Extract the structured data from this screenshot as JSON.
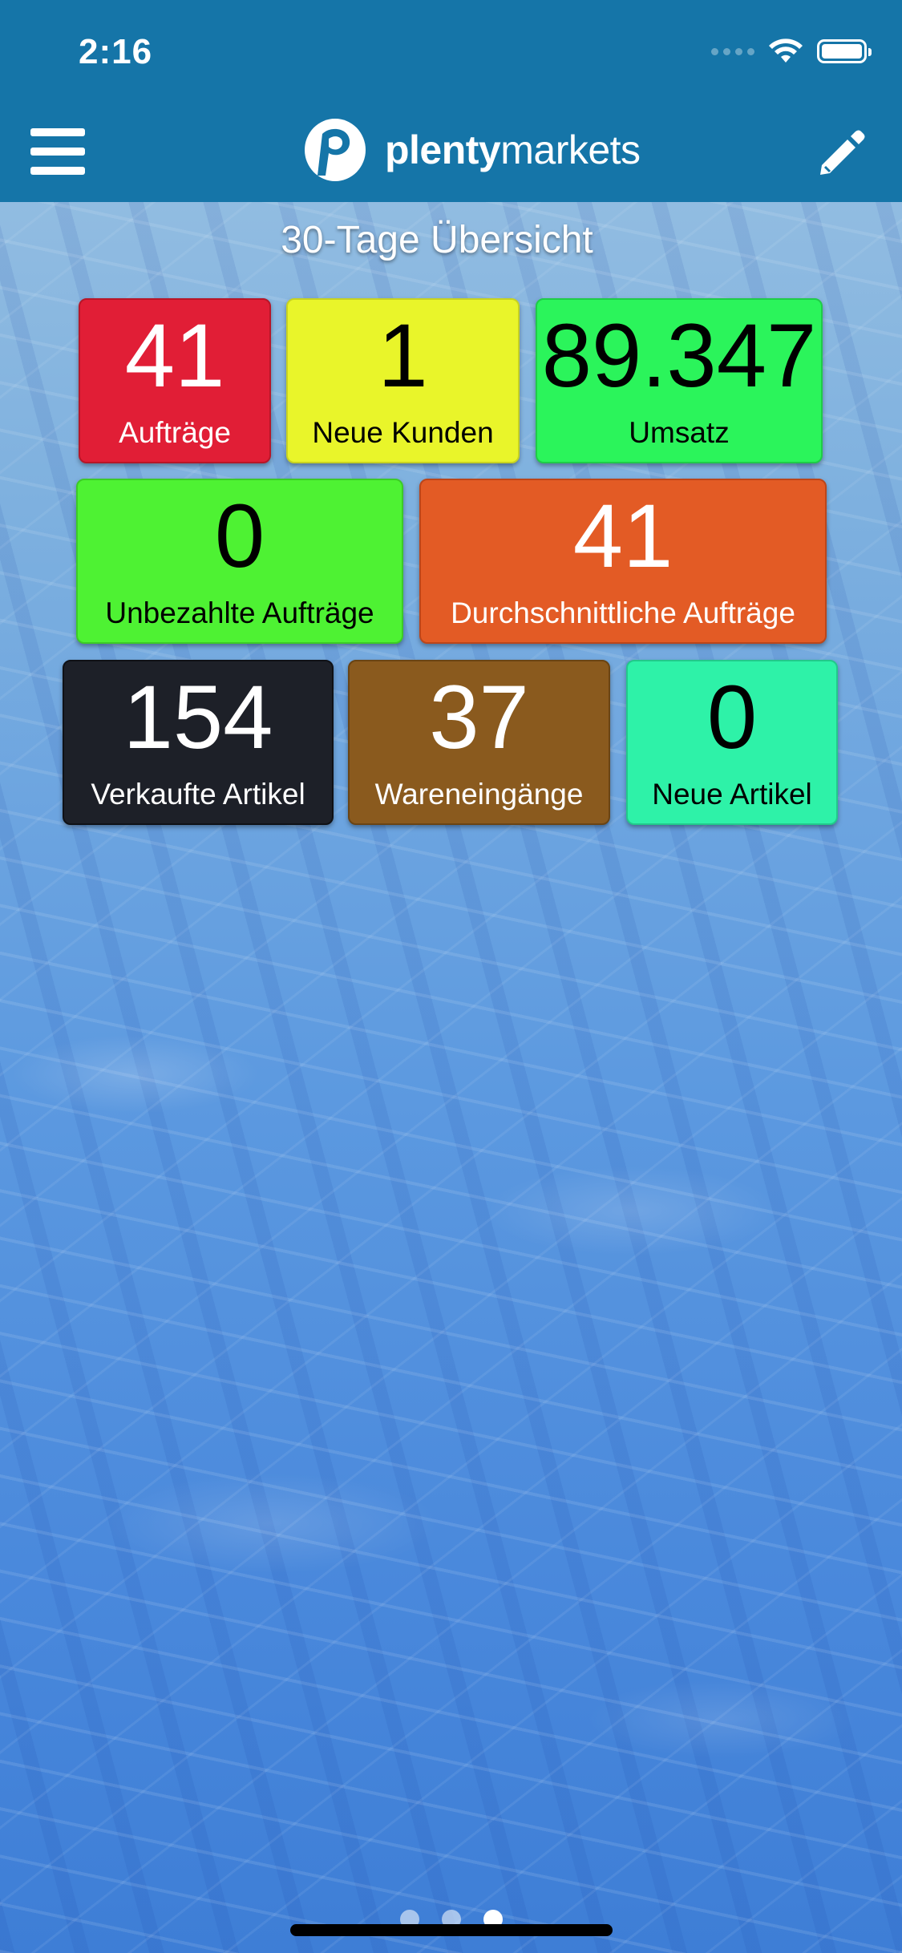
{
  "status_bar": {
    "time": "2:16",
    "icons": [
      "signal-dots-icon",
      "wifi-icon",
      "battery-icon"
    ]
  },
  "header": {
    "menu_icon": "hamburger-menu-icon",
    "logo": {
      "icon": "plentymarkets-logo-icon",
      "text_bold": "plenty",
      "text_regular": "markets"
    },
    "edit_icon": "pencil-icon",
    "background_color": "#1575a8"
  },
  "overview": {
    "title": "30-Tage Übersicht",
    "tiles": [
      {
        "value": "41",
        "label": "Aufträge",
        "color": "#e11e36"
      },
      {
        "value": "1",
        "label": "Neue Kunden",
        "color": "#e9f52a"
      },
      {
        "value": "89.347",
        "label": "Umsatz",
        "color": "#2bf45b"
      },
      {
        "value": "0",
        "label": "Unbezahlte Aufträge",
        "color": "#4ef233"
      },
      {
        "value": "41",
        "label": "Durchschnittliche Aufträge",
        "color": "#e35b25"
      },
      {
        "value": "154",
        "label": "Verkaufte Artikel",
        "color": "#1d2028"
      },
      {
        "value": "37",
        "label": "Wareneingänge",
        "color": "#8a5a1e"
      },
      {
        "value": "0",
        "label": "Neue Artikel",
        "color": "#2ef2a8"
      }
    ]
  },
  "pager": {
    "count": 3,
    "active_index": 2
  }
}
